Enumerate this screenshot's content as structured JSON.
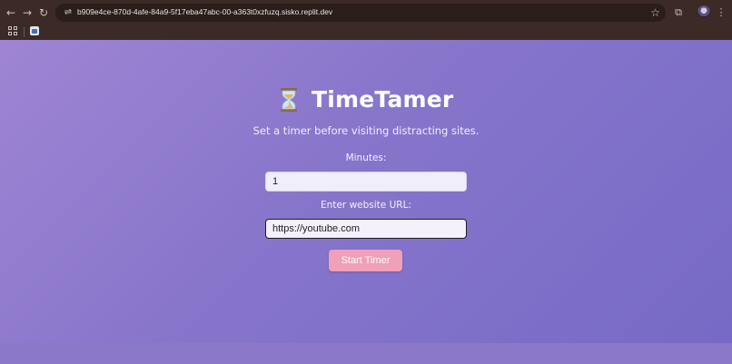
{
  "browser": {
    "url": "b909e4ce-870d-4afe-84a9-5f17eba47abc-00-a363t0xzfuzq.sisko.replit.dev",
    "back_glyph": "←",
    "forward_glyph": "→",
    "reload_glyph": "↻",
    "site_info_glyph": "⇌",
    "star_glyph": "☆",
    "extensions_glyph": "⧉",
    "menu_glyph": "⋮"
  },
  "app": {
    "title": "TimeTamer",
    "subtitle": "Set a timer before visiting distracting sites.",
    "minutes_label": "Minutes:",
    "minutes_value": "1",
    "url_label": "Enter website URL:",
    "url_value": "https://youtube.com",
    "start_button": "Start Timer"
  },
  "colors": {
    "background_gradient": [
      "#9f85d3",
      "#766ac6"
    ],
    "button": "#f0a0b8",
    "title": "#ffffff"
  }
}
